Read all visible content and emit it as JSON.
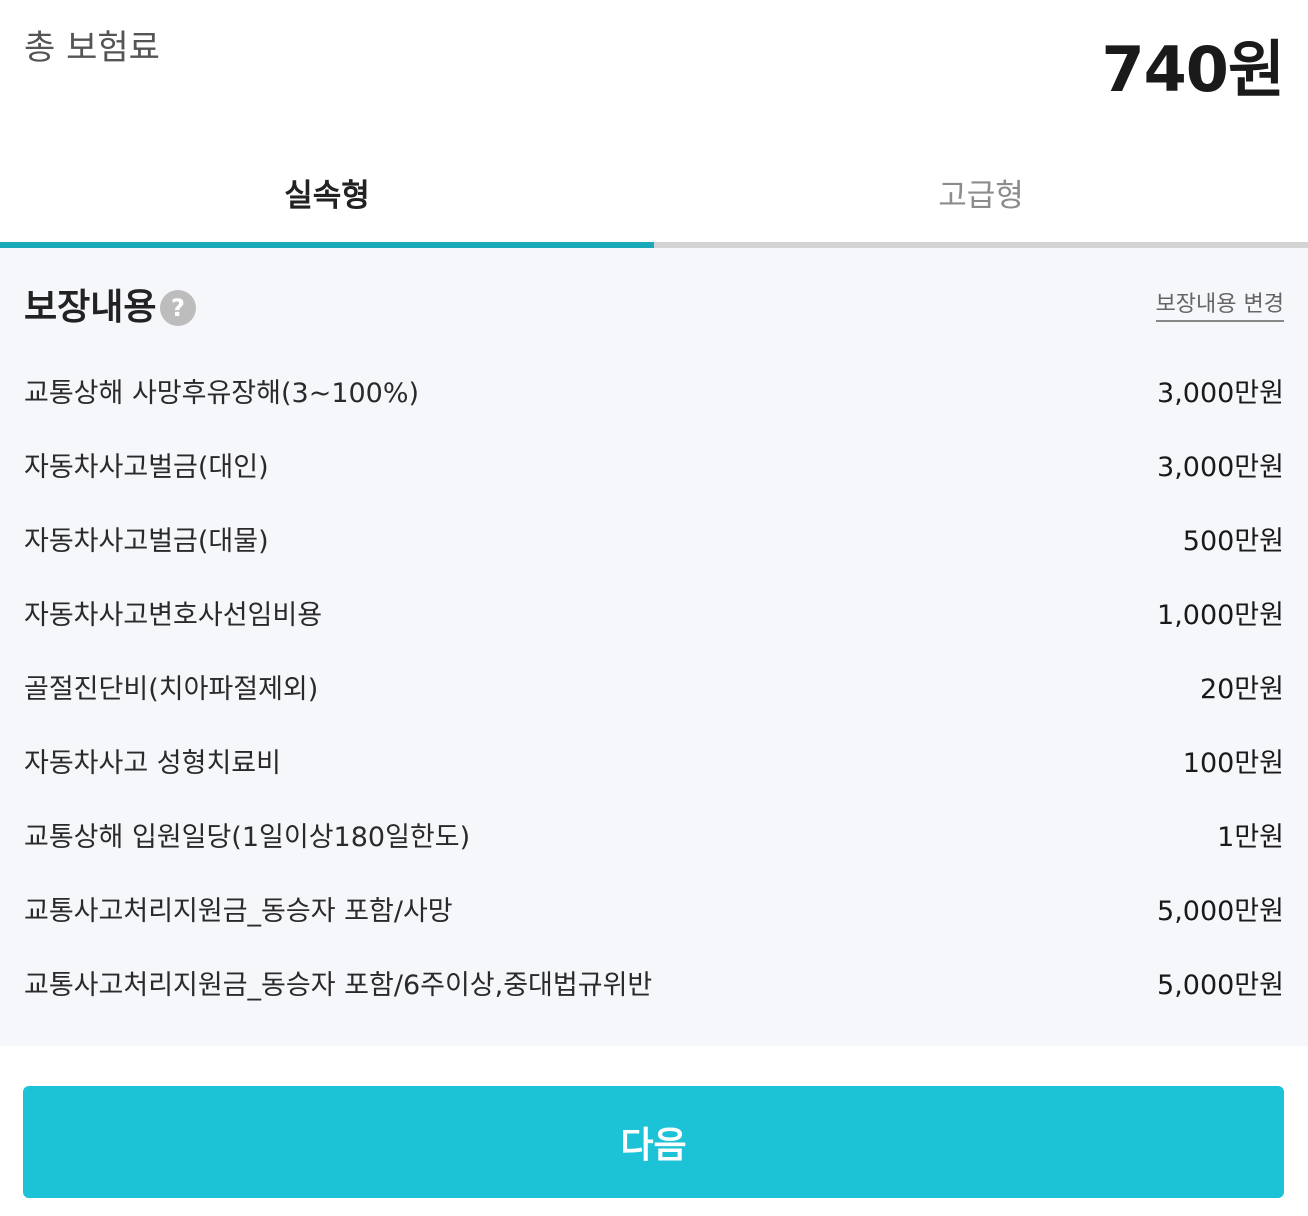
{
  "premium": {
    "label": "총 보험료",
    "value": "740원"
  },
  "tabs": [
    {
      "label": "실속형",
      "active": true
    },
    {
      "label": "고급형",
      "active": false
    }
  ],
  "coverage": {
    "title": "보장내용",
    "help_icon": "question-circle-icon",
    "change_label": "보장내용 변경",
    "items": [
      {
        "name": "교통상해 사망후유장해(3~100%)",
        "amount": "3,000만원"
      },
      {
        "name": "자동차사고벌금(대인)",
        "amount": "3,000만원"
      },
      {
        "name": "자동차사고벌금(대물)",
        "amount": "500만원"
      },
      {
        "name": "자동차사고변호사선임비용",
        "amount": "1,000만원"
      },
      {
        "name": "골절진단비(치아파절제외)",
        "amount": "20만원"
      },
      {
        "name": "자동차사고 성형치료비",
        "amount": "100만원"
      },
      {
        "name": "교통상해 입원일당(1일이상180일한도)",
        "amount": "1만원"
      },
      {
        "name": "교통사고처리지원금_동승자 포함/사망",
        "amount": "5,000만원"
      },
      {
        "name": "교통사고처리지원금_동승자 포함/6주이상,중대법규위반",
        "amount": "5,000만원"
      }
    ]
  },
  "footer": {
    "next_label": "다음"
  },
  "colors": {
    "accent": "#1aa9b8",
    "button": "#1cc3d6",
    "panel_bg": "#f6f7fb"
  }
}
